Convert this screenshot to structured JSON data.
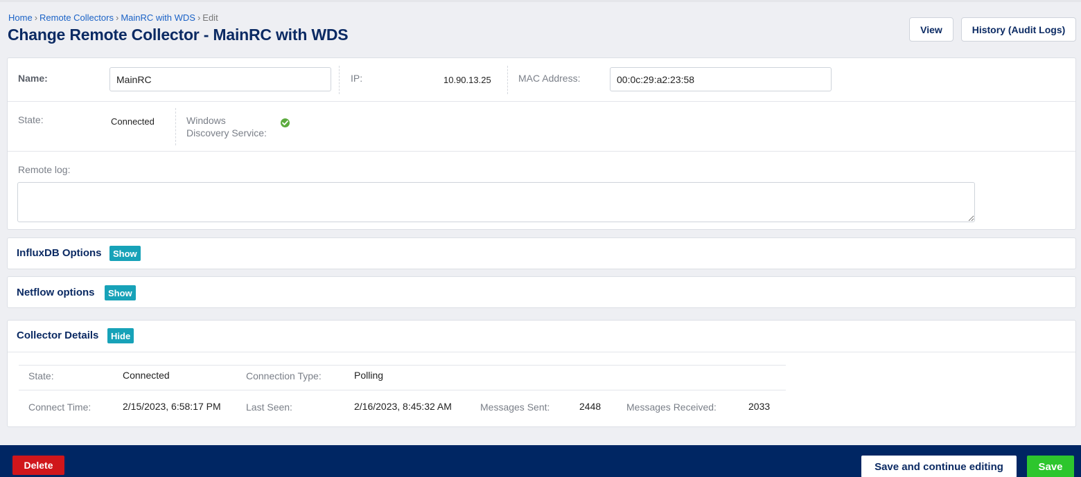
{
  "breadcrumb": {
    "items": [
      "Home",
      "Remote Collectors",
      "MainRC with WDS"
    ],
    "separator": "›",
    "current": "Edit"
  },
  "page": {
    "title": "Change Remote Collector - MainRC with WDS"
  },
  "header_actions": {
    "view_label": "View",
    "history_label": "History (Audit Logs)"
  },
  "form": {
    "name_label": "Name:",
    "name_value": "MainRC",
    "ip_label": "IP:",
    "ip_value": "10.90.13.25",
    "mac_label": "MAC Address:",
    "mac_value": "00:0c:29:a2:23:58",
    "state_label": "State:",
    "state_value": "Connected",
    "wds_label_line1": "Windows",
    "wds_label_line2": "Discovery Service:",
    "wds_status_icon": "check-circle-icon",
    "remote_log_label": "Remote log:",
    "remote_log_value": ""
  },
  "sections": {
    "influx": {
      "title": "InfluxDB Options",
      "toggle": "Show"
    },
    "netflow": {
      "title": "Netflow options",
      "toggle": "Show"
    },
    "details": {
      "title": "Collector Details",
      "toggle": "Hide"
    }
  },
  "collector_details": {
    "state_label": "State:",
    "state_value": "Connected",
    "connection_type_label": "Connection Type:",
    "connection_type_value": "Polling",
    "connect_time_label": "Connect Time:",
    "connect_time_value": "2/15/2023, 6:58:17 PM",
    "last_seen_label": "Last Seen:",
    "last_seen_value": "2/16/2023, 8:45:32 AM",
    "messages_sent_label": "Messages Sent:",
    "messages_sent_value": "2448",
    "messages_received_label": "Messages Received:",
    "messages_received_value": "2033"
  },
  "footer": {
    "delete_label": "Delete",
    "save_continue_label": "Save and continue editing",
    "save_label": "Save"
  },
  "colors": {
    "navy": "#0b2a63",
    "footer_bg": "#002663",
    "toggle_bg": "#17a2b8",
    "delete_bg": "#d0161b",
    "save_bg": "#2dc62d",
    "ok_green": "#5cab3e",
    "link_blue": "#1a62c6"
  }
}
